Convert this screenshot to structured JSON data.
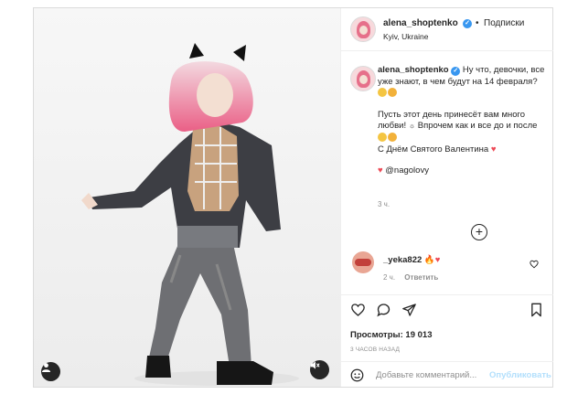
{
  "post": {
    "username": "alena_shoptenko",
    "verified_mark": "✓",
    "separator": "•",
    "follow_label": "Подписки",
    "location": "Kyiv, Ukraine",
    "more_icon": "more-horizontal-icon"
  },
  "caption": {
    "username": "alena_shoptenko",
    "line1": "Ну что, девочки, все уже знают, в чем будут на 14 февраля?",
    "line2": "Пусть этот день принесёт вам много любви! ",
    "line2b": " Впрочем как и все до и после",
    "line3": "С Днём Святого Валентина",
    "heart": "♥",
    "mention": "@nagolovy",
    "time": "3 ч."
  },
  "load_more_symbol": "+",
  "comment": {
    "username": "_yeka822",
    "text": "🔥♥",
    "time": "2 ч.",
    "reply_label": "Ответить"
  },
  "actions": {
    "views_label": "Просмотры: 19 013",
    "posted_ago": "3 ЧАСОВ НАЗАД",
    "add_comment_placeholder": "Добавьте комментарий...",
    "publish_label": "Опубликовать"
  },
  "colors": {
    "accent_blue": "#3897f0",
    "heart_red": "#ed4956",
    "publish_disabled": "#b2dffc",
    "secondary_text": "#8e8e8e",
    "border": "#dbdbdb"
  }
}
